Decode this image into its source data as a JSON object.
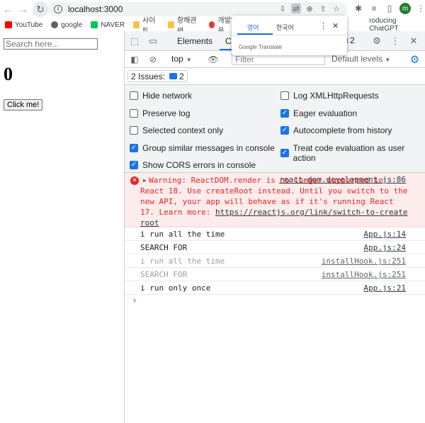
{
  "browser": {
    "url": "localhost:3000",
    "bookmarks": [
      {
        "label": "YouTube",
        "color": "#ff0000"
      },
      {
        "label": "google",
        "color": "#5f6368"
      },
      {
        "label": "NAVER",
        "color": "#03c75a"
      },
      {
        "label": "사이트",
        "color": "#f4c542"
      },
      {
        "label": "항해관련",
        "color": "#f4c542"
      },
      {
        "label": "개발일지용",
        "color": "#e53935"
      },
      {
        "label": "roducing ChatGPT",
        "color": "#5f6368"
      }
    ],
    "avatar_letter": "m"
  },
  "translate_popup": {
    "tab_english": "영어",
    "tab_korean": "한국어",
    "brand": "Google Translate"
  },
  "page": {
    "search_placeholder": "Search here...",
    "counter": "0",
    "button_label": "Click me!"
  },
  "devtools": {
    "tabs": {
      "elements": "Elements",
      "console": "Co",
      "issues_count": "2"
    },
    "toolbar": {
      "context": "top",
      "filter_placeholder": "Filter",
      "levels": "Default levels"
    },
    "issues_bar": {
      "label": "2 Issues:",
      "count": "2"
    },
    "settings": [
      {
        "label": "Hide network",
        "checked": false
      },
      {
        "label": "Log XMLHttpRequests",
        "checked": false
      },
      {
        "label": "Preserve log",
        "checked": false
      },
      {
        "label": "Eager evaluation",
        "checked": true
      },
      {
        "label": "Selected context only",
        "checked": false
      },
      {
        "label": "Autocomplete from history",
        "checked": true
      },
      {
        "label": "Group similar messages in console",
        "checked": true
      },
      {
        "label": "Treat code evaluation as user action",
        "checked": true
      },
      {
        "label": "Show CORS errors in console",
        "checked": true
      }
    ],
    "warning": {
      "text_lead": "Warning: ReactDOM.render is no",
      "text_rest": "longer supported in React 18. Use createRoot instead. Until you switch to the new API, your app will behave as if it's running React 17. Learn more:",
      "link": "https://reactjs.org/link/switch-to-createroot",
      "source": "react-dom.development.js:86"
    },
    "logs": [
      {
        "text": "i run all the time",
        "source": "App.js:14",
        "faded": false
      },
      {
        "text": "SEARCH FOR",
        "source": "App.js:24",
        "faded": false
      },
      {
        "text": "i run all the time",
        "source": "installHook.js:251",
        "faded": true
      },
      {
        "text": "SEARCH FOR",
        "source": "installHook.js:251",
        "faded": true
      },
      {
        "text": "i run only once",
        "source": "App.js:21",
        "faded": false
      }
    ],
    "prompt": "›"
  }
}
